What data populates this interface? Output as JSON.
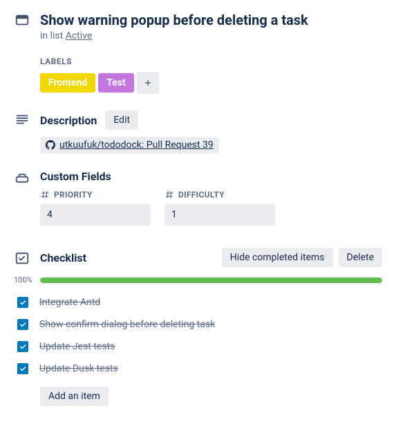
{
  "header": {
    "title": "Show warning popup before deleting a task",
    "in_list_prefix": "in list ",
    "list_name": "Active"
  },
  "labels": {
    "title": "LABELS",
    "items": [
      {
        "text": "Frontend",
        "color": "#f2d600"
      },
      {
        "text": "Test",
        "color": "#c377e0"
      }
    ]
  },
  "description": {
    "title": "Description",
    "edit_label": "Edit",
    "link_text": "utkuufuk/tododock: Pull Request 39"
  },
  "custom_fields": {
    "title": "Custom Fields",
    "fields": [
      {
        "label": "PRIORITY",
        "value": "4"
      },
      {
        "label": "DIFFICULTY",
        "value": "1"
      }
    ]
  },
  "checklist": {
    "title": "Checklist",
    "hide_label": "Hide completed items",
    "delete_label": "Delete",
    "progress_pct": "100%",
    "progress_fill": 100,
    "items": [
      {
        "text": "Integrate Antd",
        "checked": true
      },
      {
        "text": "Show confirm dialog before deleting task",
        "checked": true
      },
      {
        "text": "Update Jest tests",
        "checked": true
      },
      {
        "text": "Update Dusk tests",
        "checked": true
      }
    ],
    "add_item_label": "Add an item"
  }
}
